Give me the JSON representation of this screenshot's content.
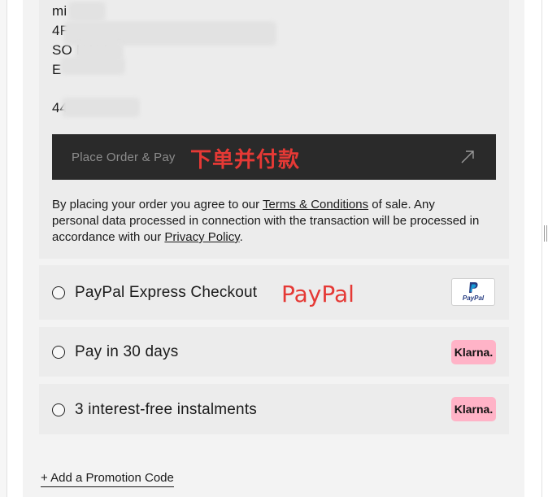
{
  "address": {
    "line1": "mi",
    "line2": "4F",
    "line3": "SO      HALL,",
    "line4": "E",
    "phone": "44           8528"
  },
  "place_order": {
    "label": "Place Order & Pay",
    "annotation": "下单并付款"
  },
  "terms": {
    "prefix": "By placing your order you agree to our ",
    "terms_link": "Terms & Conditions",
    "middle": " of sale. Any personal data processed in connection with the transaction will be processed in accordance with our ",
    "privacy_link": "Privacy Policy",
    "suffix": "."
  },
  "payment_options": [
    {
      "label": "PayPal Express Checkout",
      "annotation": "PayPal",
      "badge_text": "PayPal"
    },
    {
      "label": "Pay in 30 days",
      "badge_text": "Klarna."
    },
    {
      "label": "3 interest-free instalments",
      "badge_text": "Klarna."
    }
  ],
  "promo": {
    "label": "+ Add a Promotion Code"
  },
  "colors": {
    "button_bg": "#2a2a2a",
    "annotation_red": "#e53935",
    "klarna_pink": "#ffb3c7",
    "card_bg": "#ececec"
  }
}
